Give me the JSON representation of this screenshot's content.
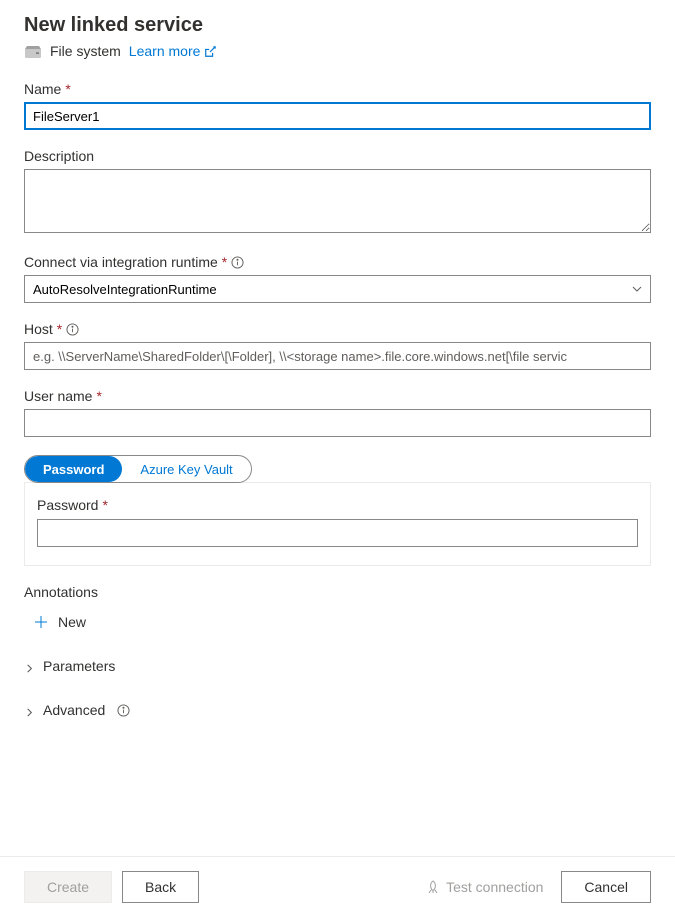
{
  "header": {
    "title": "New linked service",
    "subtitle": "File system",
    "learn_more": "Learn more"
  },
  "form": {
    "name_label": "Name",
    "name_value": "FileServer1",
    "description_label": "Description",
    "description_value": "",
    "runtime_label": "Connect via integration runtime",
    "runtime_value": "AutoResolveIntegrationRuntime",
    "host_label": "Host",
    "host_placeholder": "e.g. \\\\ServerName\\SharedFolder\\[\\Folder], \\\\<storage name>.file.core.windows.net[\\file servic",
    "host_value": "",
    "username_label": "User name",
    "username_value": "",
    "tabs": {
      "password": "Password",
      "keyvault": "Azure Key Vault"
    },
    "password_label": "Password",
    "password_value": "",
    "annotations_label": "Annotations",
    "new_label": "New",
    "parameters_label": "Parameters",
    "advanced_label": "Advanced"
  },
  "footer": {
    "create": "Create",
    "back": "Back",
    "test": "Test connection",
    "cancel": "Cancel"
  }
}
